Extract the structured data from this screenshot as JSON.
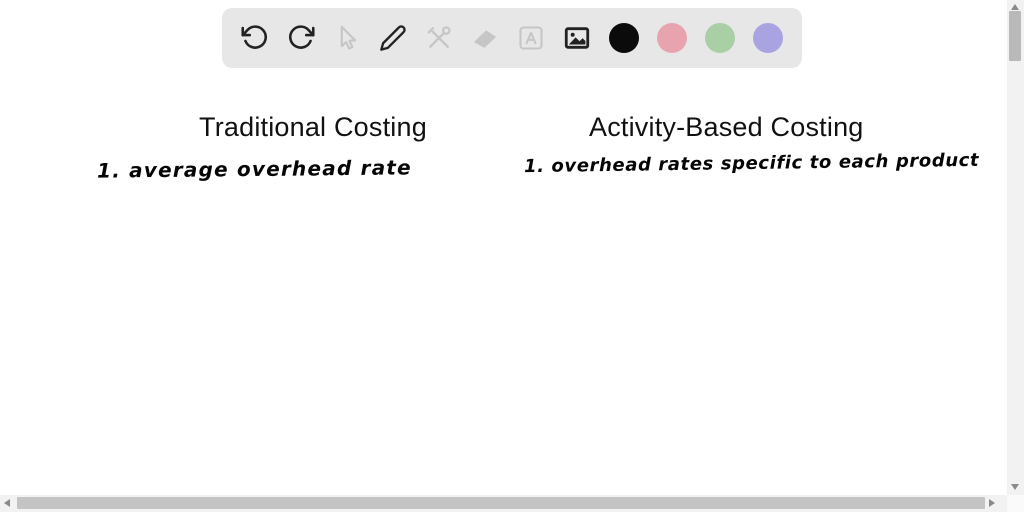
{
  "whiteboard": {
    "background": "#ffffff",
    "columns": [
      {
        "title": "Traditional Costing",
        "handwritten_note": "1. average overhead rate"
      },
      {
        "title": "Activity-Based Costing",
        "handwritten_note": "1. overhead rates specific to each product"
      }
    ]
  },
  "toolbar": {
    "background": "#e7e7e7",
    "icon_color_enabled": "#222222",
    "icon_color_disabled": "#c6c6c6",
    "buttons": [
      {
        "icon": "undo-icon",
        "enabled": true
      },
      {
        "icon": "redo-icon",
        "enabled": true
      },
      {
        "icon": "cursor-icon",
        "enabled": false
      },
      {
        "icon": "pencil-icon",
        "enabled": true
      },
      {
        "icon": "tools-icon",
        "enabled": false
      },
      {
        "icon": "eraser-icon",
        "enabled": false
      },
      {
        "icon": "text-icon",
        "enabled": false
      },
      {
        "icon": "image-icon",
        "enabled": true
      }
    ],
    "color_swatches": [
      {
        "name": "black",
        "hex": "#0b0b0b"
      },
      {
        "name": "pink",
        "hex": "#e7a4ae"
      },
      {
        "name": "green",
        "hex": "#a9cfa5"
      },
      {
        "name": "purple",
        "hex": "#aaa3e1"
      }
    ]
  },
  "scrollbars": {
    "track_color": "#f2f2f2",
    "thumb_color": "#bdbdbd",
    "arrow_color": "#8a8a8a"
  }
}
